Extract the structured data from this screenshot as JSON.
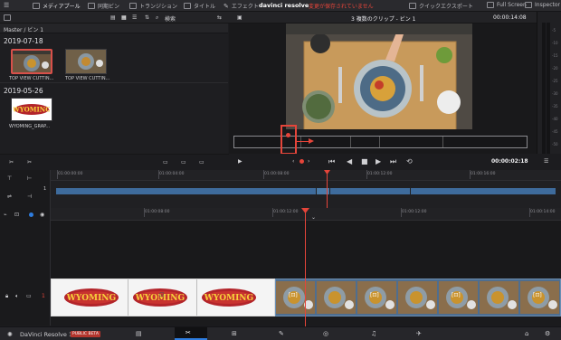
{
  "topbar": {
    "media_pool": "メディアプール",
    "sync_bin": "同期ビン",
    "transitions": "トランジション",
    "titles": "タイトル",
    "effects": "エフェクト",
    "project_name": "davinci resolve",
    "unsaved": "変更が保存されていません",
    "quick_export": "クイックエクスポート",
    "full_screen": "Full Screen",
    "inspector": "Inspector"
  },
  "toolbar": {
    "search": "検索",
    "clip_title": "3 複数のクリップ - ビン 1",
    "timecode": "00:00:14:08"
  },
  "media_pool": {
    "breadcrumb": "Master / ビン 1",
    "groups": [
      {
        "date": "2019-07-18",
        "clips": [
          "TOP VIEW CUTTIN...",
          "TOP VIEW CUTTIN..."
        ]
      },
      {
        "date": "2019-05-26",
        "clips": [
          "WYOMING_GRAP..."
        ]
      }
    ]
  },
  "logo_text": "WYOMING",
  "transport": {
    "timecode": "00:00:02:18"
  },
  "upper_ruler": [
    "01:00:00:00",
    "01:00:04:00",
    "01:00:08:00",
    "01:00:12:00",
    "01:00:16:00"
  ],
  "lower_ruler": [
    "01:00:08:00",
    "01:00:12:00",
    "01:00:12:00",
    "01:00:14:00"
  ],
  "track_number": "1",
  "meter_ticks": [
    "-5",
    "-10",
    "-15",
    "-20",
    "-25",
    "-30",
    "-35",
    "-40",
    "-45",
    "-50"
  ],
  "footer": {
    "app_name": "DaVinci Resolve 17",
    "badge": "PUBLIC BETA"
  },
  "colors": {
    "accent": "#e5453a",
    "clip_blue": "#3e6b9c",
    "selection": "#d8504a"
  }
}
